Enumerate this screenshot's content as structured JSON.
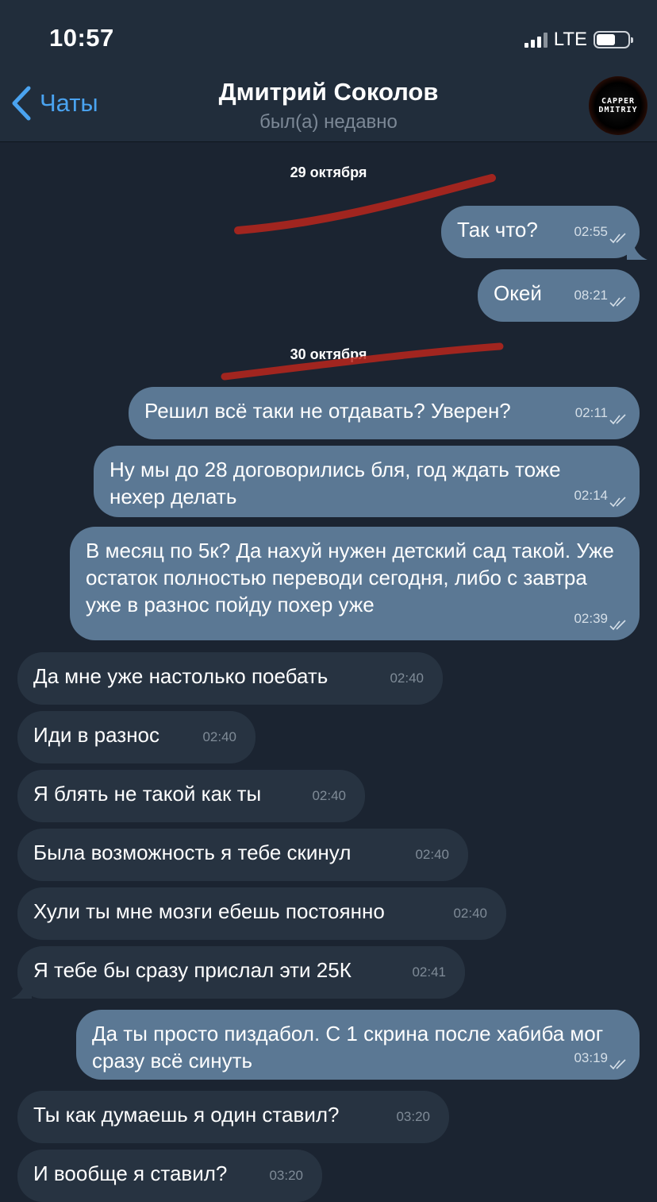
{
  "status_bar": {
    "time": "10:57",
    "network": "LTE"
  },
  "header": {
    "back_label": "Чаты",
    "contact_name": "Дмитрий Соколов",
    "contact_status": "был(а) недавно",
    "avatar_text_line1": "CAPPER",
    "avatar_text_line2": "DMITRIY"
  },
  "dates": [
    "29 октября",
    "30 октября"
  ],
  "messages": [
    {
      "dir": "out",
      "text": "Так что?",
      "time": "02:55"
    },
    {
      "dir": "out",
      "text": "Окей",
      "time": "08:21"
    },
    {
      "dir": "out",
      "text": "Решил всё таки не отдавать? Уверен?",
      "time": "02:11"
    },
    {
      "dir": "out",
      "text": "Ну мы до 28 договорились бля, год ждать тоже нехер делать",
      "time": "02:14"
    },
    {
      "dir": "out",
      "text": "В месяц по 5к? Да нахуй нужен детский сад такой. Уже остаток полностью переводи сегодня, либо с завтра уже в разнос пойду похер уже",
      "time": "02:39"
    },
    {
      "dir": "in",
      "text": "Да мне уже настолько поебать",
      "time": "02:40"
    },
    {
      "dir": "in",
      "text": "Иди в разнос",
      "time": "02:40"
    },
    {
      "dir": "in",
      "text": "Я блять не такой как ты",
      "time": "02:40"
    },
    {
      "dir": "in",
      "text": "Была возможность я тебе скинул",
      "time": "02:40"
    },
    {
      "dir": "in",
      "text": "Хули ты мне мозги ебешь постоянно",
      "time": "02:40"
    },
    {
      "dir": "in",
      "text": "Я тебе бы сразу прислал эти 25К",
      "time": "02:41"
    },
    {
      "dir": "out",
      "text": "Да ты просто пиздабол. С 1 скрина после хабиба мог сразу всё синуть",
      "time": "03:19"
    },
    {
      "dir": "in",
      "text": "Ты как думаешь я один ставил?",
      "time": "03:20"
    },
    {
      "dir": "in",
      "text": "И вообще я ставил?",
      "time": "03:20"
    }
  ],
  "colors": {
    "background": "#1b2431",
    "header": "#212d3b",
    "outgoing_bubble": "#5b7894",
    "incoming_bubble": "#273341",
    "accent": "#4aa3f0",
    "scribble": "#b8261c"
  }
}
